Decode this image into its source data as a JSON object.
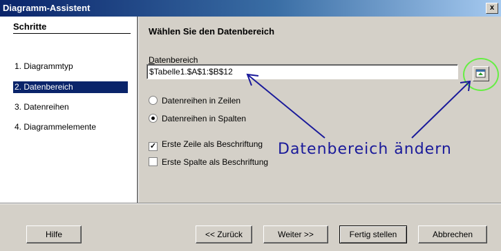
{
  "window": {
    "title": "Diagramm-Assistent",
    "close_label": "x"
  },
  "sidebar": {
    "heading": "Schritte",
    "steps": [
      {
        "label": "1. Diagrammtyp",
        "selected": false
      },
      {
        "label": "2. Datenbereich",
        "selected": true
      },
      {
        "label": "3. Datenreihen",
        "selected": false
      },
      {
        "label": "4. Diagrammelemente",
        "selected": false
      }
    ]
  },
  "main": {
    "heading": "Wählen Sie den Datenbereich",
    "range_label": "Datenbereich",
    "range_value": "$Tabelle1.$A$1:$B$12",
    "radio_rows": {
      "label": "Datenreihen in Zeilen",
      "checked": false
    },
    "radio_cols": {
      "label": "Datenreihen in Spalten",
      "checked": true
    },
    "check_first_row": {
      "label": "Erste Zeile als Beschriftung",
      "checked": true
    },
    "check_first_col": {
      "label": "Erste Spalte als Beschriftung",
      "checked": false
    }
  },
  "annotation": {
    "text": "Datenbereich ändern",
    "color": "#1a1a9a",
    "circle_color": "#66ee44"
  },
  "buttons": {
    "help": "Hilfe",
    "back": "<< Zurück",
    "next": "Weiter >>",
    "finish": "Fertig stellen",
    "cancel": "Abbrechen"
  }
}
